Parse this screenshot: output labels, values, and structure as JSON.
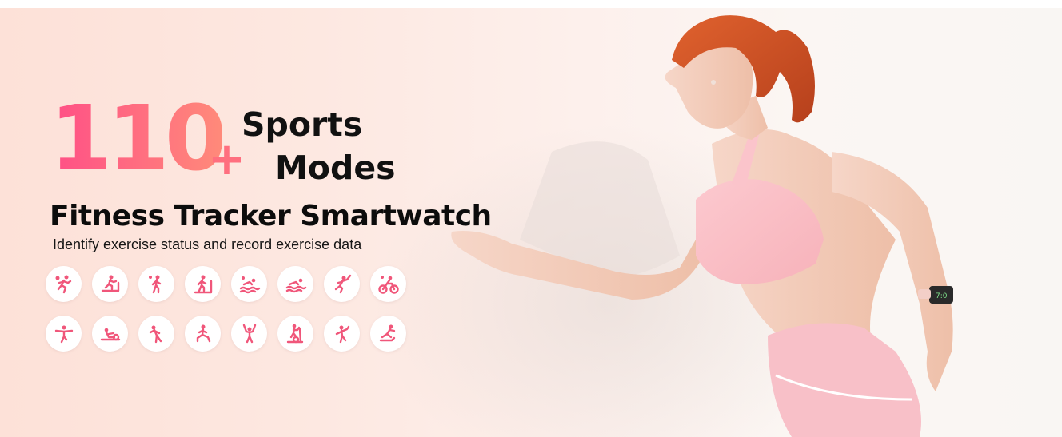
{
  "headline": {
    "number": "110",
    "plus": "+",
    "line1": "Sports",
    "line2": "Modes"
  },
  "subtitle": "Fitness Tracker Smartwatch",
  "description": "Identify exercise status and record exercise data",
  "icons_row1": [
    "running-sun-icon",
    "treadmill-icon",
    "walking-sun-icon",
    "indoor-walk-icon",
    "outdoor-swim-icon",
    "pool-swim-icon",
    "badminton-icon",
    "cycling-sun-icon"
  ],
  "icons_row2": [
    "yoga-icon",
    "rowing-icon",
    "stretching-icon",
    "lunge-icon",
    "strength-icon",
    "elliptical-icon",
    "dance-icon",
    "skating-icon"
  ],
  "colors": {
    "accent": "#f0567a",
    "number_gradient": [
      "#ff4f86",
      "#ff8a7a"
    ],
    "top_bg": "#fde1d8"
  },
  "watch": {
    "time": "7:0"
  }
}
